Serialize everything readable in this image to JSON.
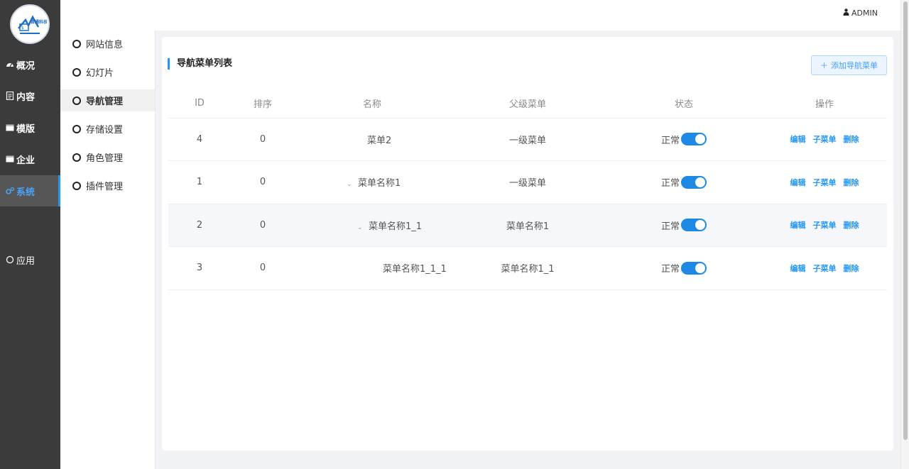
{
  "sidebar": {
    "logo_text": "晋通科技",
    "items": [
      {
        "label": "概况",
        "icon": "dashboard-icon"
      },
      {
        "label": "内容",
        "icon": "document-icon"
      },
      {
        "label": "模版",
        "icon": "template-icon"
      },
      {
        "label": "企业",
        "icon": "enterprise-icon"
      },
      {
        "label": "系统",
        "icon": "gears-icon",
        "active": true
      },
      {
        "label": "应用",
        "icon": "circle-icon"
      }
    ]
  },
  "topbar": {
    "user": "ADMIN"
  },
  "submenu": {
    "items": [
      {
        "label": "网站信息"
      },
      {
        "label": "幻灯片"
      },
      {
        "label": "导航管理",
        "active": true
      },
      {
        "label": "存储设置"
      },
      {
        "label": "角色管理"
      },
      {
        "label": "插件管理"
      }
    ]
  },
  "main": {
    "title": "导航菜单列表",
    "add_button": "添加导航菜单",
    "columns": {
      "id": "ID",
      "sort": "排序",
      "name": "名称",
      "parent": "父级菜单",
      "status": "状态",
      "ops": "操作"
    },
    "rows": [
      {
        "id": "4",
        "sort": "0",
        "name": "菜单2",
        "parent": "一级菜单",
        "status": "正常"
      },
      {
        "id": "1",
        "sort": "0",
        "name": "菜单名称1",
        "parent": "一级菜单",
        "status": "正常"
      },
      {
        "id": "2",
        "sort": "0",
        "name": "菜单名称1_1",
        "parent": "菜单名称1",
        "status": "正常"
      },
      {
        "id": "3",
        "sort": "0",
        "name": "菜单名称1_1_1",
        "parent": "菜单名称1_1",
        "status": "正常"
      }
    ],
    "ops": {
      "edit": "编辑",
      "submenu": "子菜单",
      "delete": "删除"
    }
  },
  "colors": {
    "accent": "#2196f3",
    "sidebar_bg": "#3b3b3b",
    "switch_on": "#1e88e5"
  }
}
